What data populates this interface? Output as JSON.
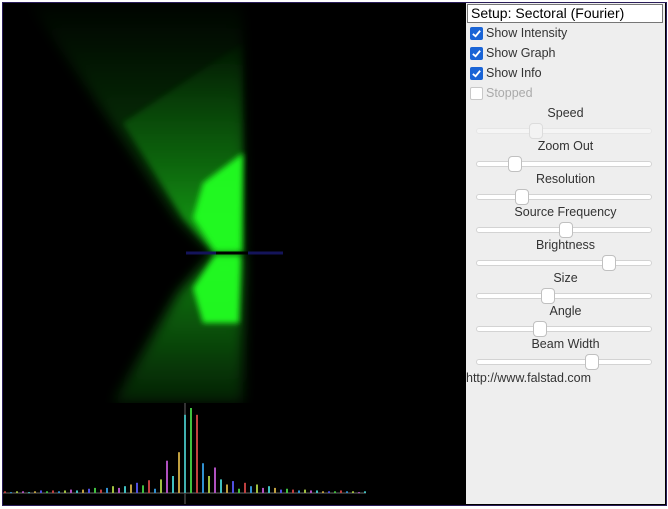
{
  "setup": {
    "selected": "Setup: Sectoral (Fourier)"
  },
  "checkboxes": [
    {
      "label": "Show Intensity",
      "checked": true,
      "disabled": false
    },
    {
      "label": "Show Graph",
      "checked": true,
      "disabled": false
    },
    {
      "label": "Show Info",
      "checked": true,
      "disabled": false
    },
    {
      "label": "Stopped",
      "checked": false,
      "disabled": true
    }
  ],
  "sliders": [
    {
      "label": "Speed",
      "value": 0.34,
      "disabled": true
    },
    {
      "label": "Zoom Out",
      "value": 0.22,
      "disabled": false
    },
    {
      "label": "Resolution",
      "value": 0.26,
      "disabled": false
    },
    {
      "label": "Source Frequency",
      "value": 0.51,
      "disabled": false
    },
    {
      "label": "Brightness",
      "value": 0.76,
      "disabled": false
    },
    {
      "label": "Size",
      "value": 0.41,
      "disabled": false
    },
    {
      "label": "Angle",
      "value": 0.36,
      "disabled": false
    },
    {
      "label": "Beam Width",
      "value": 0.66,
      "disabled": false
    }
  ],
  "footer": {
    "link": "http://www.falstad.com"
  },
  "colors": {
    "field": "#22ff22",
    "checkbox": "#1a64d6",
    "panel_bg": "#eeeeee",
    "border": "#2a1d5a"
  },
  "graph": {
    "bars": [
      0.02,
      0.01,
      0.02,
      0.02,
      0.01,
      0.02,
      0.03,
      0.02,
      0.03,
      0.02,
      0.03,
      0.04,
      0.03,
      0.04,
      0.05,
      0.06,
      0.04,
      0.06,
      0.08,
      0.06,
      0.08,
      0.1,
      0.12,
      0.09,
      0.15,
      0.05,
      0.16,
      0.38,
      0.2,
      0.48,
      0.92,
      1.0,
      0.92,
      0.35,
      0.2,
      0.3,
      0.16,
      0.1,
      0.14,
      0.05,
      0.12,
      0.08,
      0.1,
      0.06,
      0.08,
      0.06,
      0.04,
      0.05,
      0.04,
      0.03,
      0.04,
      0.03,
      0.03,
      0.02,
      0.02,
      0.02,
      0.03,
      0.02,
      0.02,
      0.01,
      0.02
    ]
  }
}
